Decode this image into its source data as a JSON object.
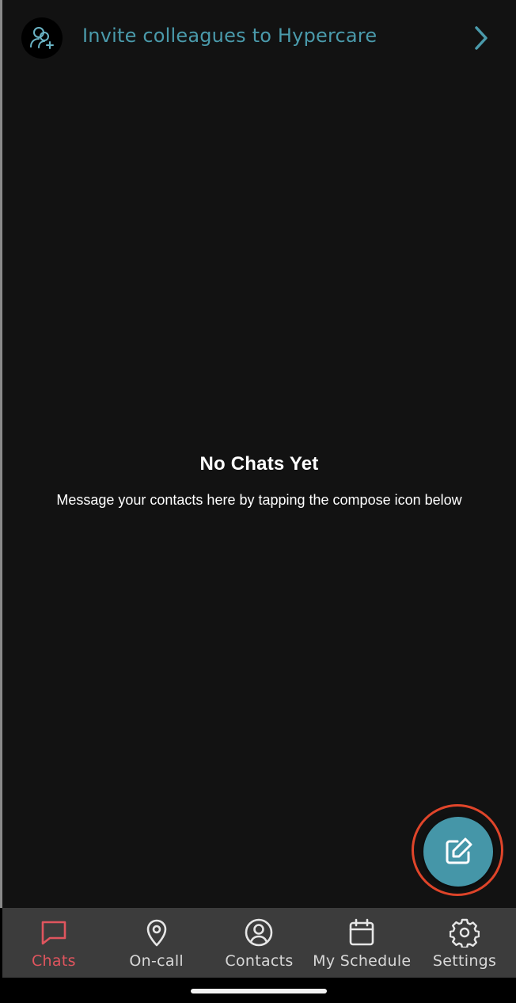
{
  "banner": {
    "invite_text": "Invite colleagues to Hypercare"
  },
  "empty_state": {
    "title": "No Chats Yet",
    "subtitle": "Message your contacts here by tapping the compose icon below"
  },
  "fab": {
    "icon": "compose-icon"
  },
  "tabs": [
    {
      "label": "Chats",
      "icon": "chat-bubble-icon",
      "active": true
    },
    {
      "label": "On-call",
      "icon": "location-pin-icon",
      "active": false
    },
    {
      "label": "Contacts",
      "icon": "user-circle-icon",
      "active": false
    },
    {
      "label": "My Schedule",
      "icon": "calendar-icon",
      "active": false
    },
    {
      "label": "Settings",
      "icon": "gear-icon",
      "active": false
    }
  ],
  "colors": {
    "accent": "#4596a8",
    "active_tab": "#e0555e",
    "highlight_ring": "#e0452a",
    "background": "#121212",
    "tabbar": "#3c3c3c"
  }
}
